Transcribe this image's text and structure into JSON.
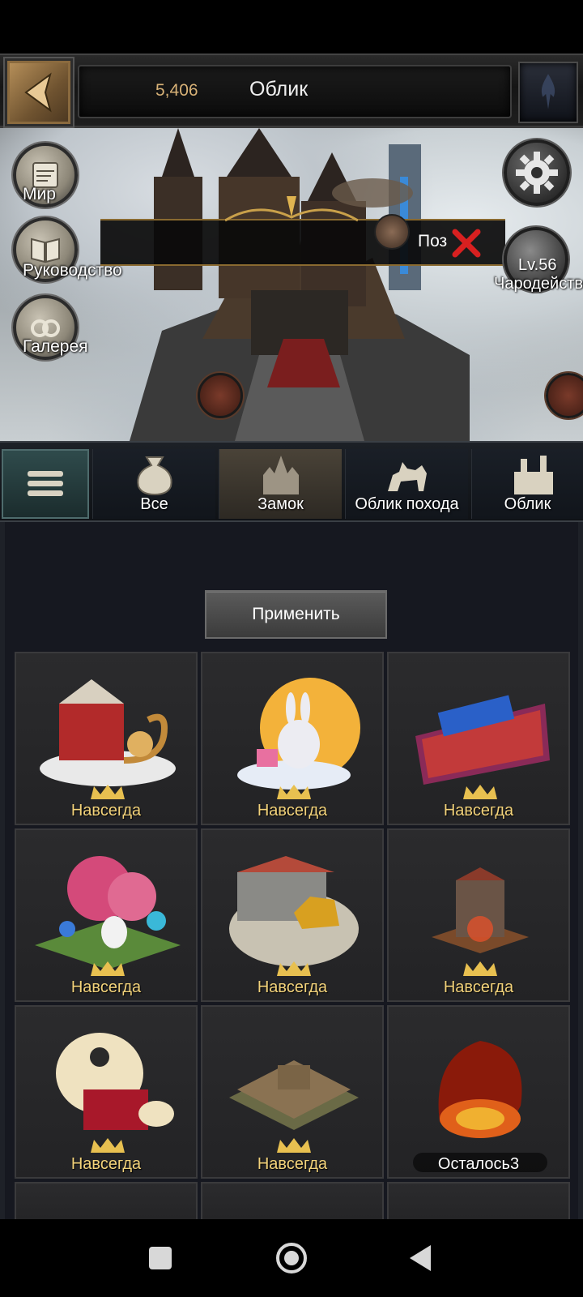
{
  "header": {
    "coins": "5,406",
    "title": "Облик"
  },
  "scene": {
    "world_label": "Мир",
    "guide_label": "Руководство",
    "gallery_label": "Галерея",
    "banner_text": "Поз",
    "level": "Lv.56",
    "level_name": "Чародейство"
  },
  "tabs": [
    {
      "label": "Все"
    },
    {
      "label": "Замок"
    },
    {
      "label": "Облик похода"
    },
    {
      "label": "Облик"
    }
  ],
  "apply_label": "Применить",
  "cards": [
    {
      "label": "Навсегда"
    },
    {
      "label": "Навсегда"
    },
    {
      "label": "Навсегда"
    },
    {
      "label": "Навсегда"
    },
    {
      "label": "Навсегда"
    },
    {
      "label": "Навсегда"
    },
    {
      "label": "Навсегда"
    },
    {
      "label": "Навсегда"
    },
    {
      "label": "Осталось3"
    }
  ],
  "colors": {
    "gold_text": "#f2d27a",
    "active_tab": "#4a4338",
    "menu_teal": "#2f4b4c"
  }
}
